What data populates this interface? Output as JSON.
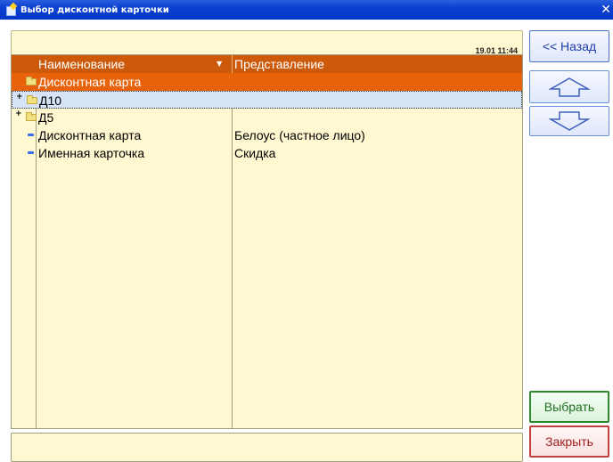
{
  "window": {
    "title": "Выбор дисконтной карточки"
  },
  "datebar": {
    "datetime": "19.01 11:44"
  },
  "table": {
    "columns": [
      "Наименование",
      "Представление"
    ],
    "rows": [
      {
        "name": "Дисконтная карта",
        "value": "",
        "type": "folder",
        "state": "selected"
      },
      {
        "name": "Д10",
        "value": "",
        "type": "folder",
        "state": "focused"
      },
      {
        "name": "Д5",
        "value": "",
        "type": "folder",
        "state": "normal"
      },
      {
        "name": "Дисконтная карта",
        "value": "Белоус (частное лицо)",
        "type": "item",
        "state": "normal"
      },
      {
        "name": "Именная карточка",
        "value": "Скидка",
        "type": "item",
        "state": "normal"
      }
    ]
  },
  "buttons": {
    "back": "<< Назад",
    "up": "up-arrow-icon",
    "down": "down-arrow-icon",
    "select": "Выбрать",
    "close": "Закрыть"
  },
  "colors": {
    "header": "#cc5a0a",
    "selected_row": "#e8620a",
    "grid_bg": "#fff8d0",
    "title_bar": "#0a3fd0"
  }
}
